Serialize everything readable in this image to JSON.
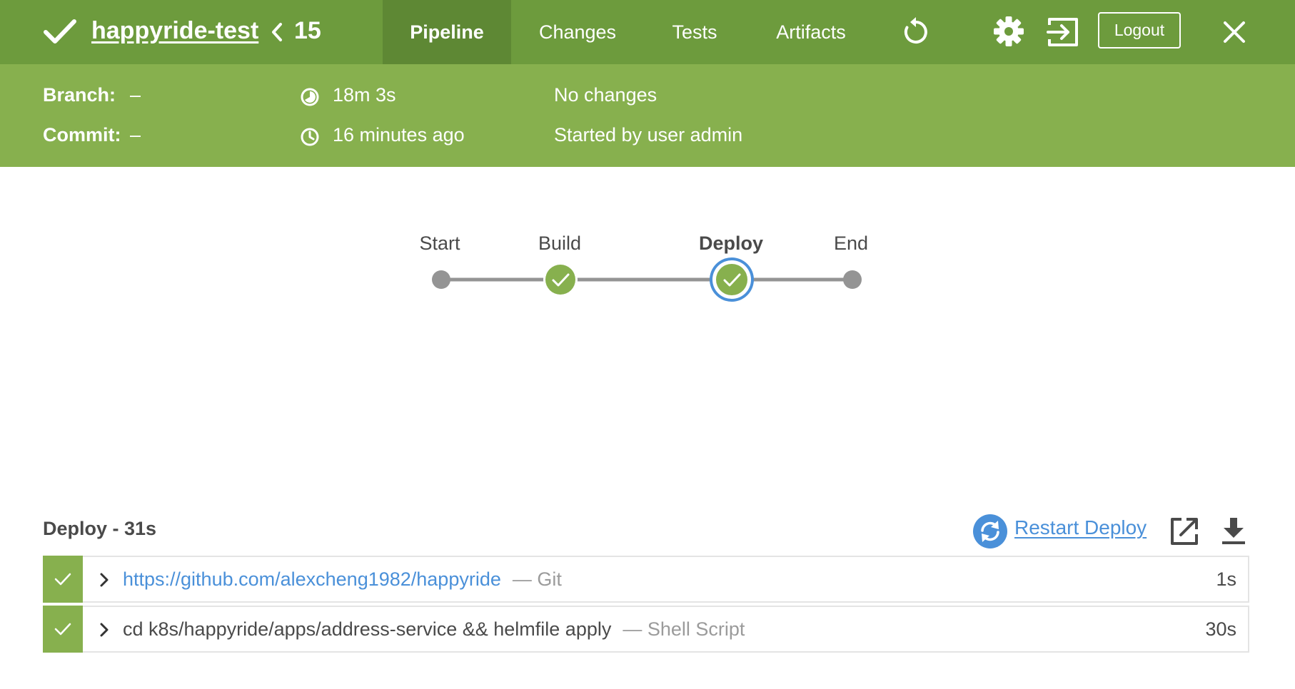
{
  "header": {
    "job_name": "happyride-test",
    "run_number": "15",
    "tabs": [
      {
        "label": "Pipeline",
        "active": true
      },
      {
        "label": "Changes",
        "active": false
      },
      {
        "label": "Tests",
        "active": false
      },
      {
        "label": "Artifacts",
        "active": false
      }
    ],
    "logout_label": "Logout",
    "icons": [
      "check-icon",
      "chevron-left-icon",
      "replay-icon",
      "gear-icon",
      "sign-in-icon",
      "close-icon"
    ]
  },
  "run_info": {
    "branch_label": "Branch:",
    "branch_value": "–",
    "commit_label": "Commit:",
    "commit_value": "–",
    "duration": "18m 3s",
    "started": "16 minutes ago",
    "changes": "No changes",
    "cause": "Started by user admin"
  },
  "pipeline": {
    "stages": [
      {
        "name": "Start",
        "status": "none"
      },
      {
        "name": "Build",
        "status": "success"
      },
      {
        "name": "Deploy",
        "status": "success",
        "selected": true
      },
      {
        "name": "End",
        "status": "none"
      }
    ]
  },
  "stage_detail": {
    "title": "Deploy - 31s",
    "restart_label": "Restart Deploy",
    "steps": [
      {
        "text": "https://github.com/alexcheng1982/happyride",
        "type": "— Git",
        "duration": "1s",
        "is_link": true
      },
      {
        "text": "cd k8s/happyride/apps/address-service && helmfile apply",
        "type": "— Shell Script",
        "duration": "30s",
        "is_link": false
      }
    ]
  },
  "colors": {
    "header_green": "#6d9b3d",
    "subheader_green": "#87b04e",
    "active_tab": "#5e8834",
    "link_blue": "#4a90d9",
    "node_gray": "#949494"
  }
}
